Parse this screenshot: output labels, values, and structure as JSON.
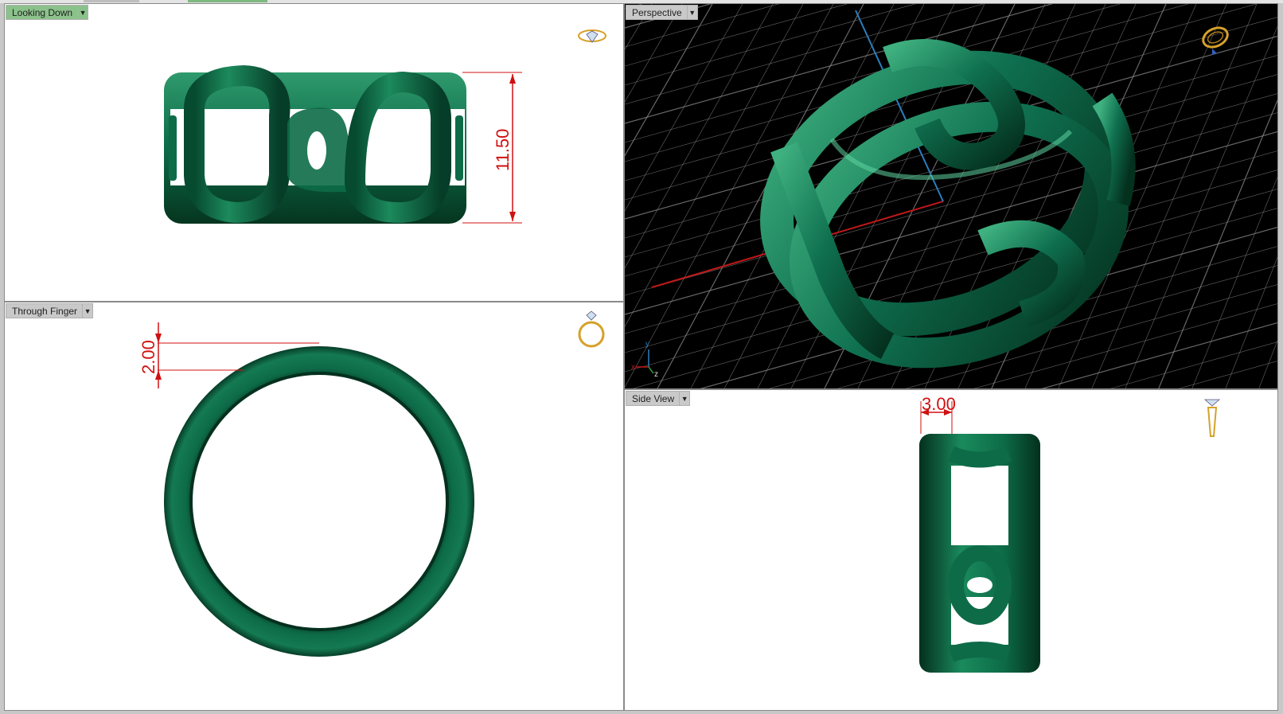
{
  "viewports": {
    "top_left": {
      "label": "Looking Down",
      "dimension": "11.50"
    },
    "top_right": {
      "label": "Perspective",
      "axis_y": "y",
      "axis_x": "x",
      "axis_z": "z"
    },
    "bottom_left": {
      "label": "Through Finger",
      "dimension": "2.00"
    },
    "bottom_right": {
      "label": "Side View",
      "dimension": "3.00"
    }
  },
  "icons": {
    "dropdown": "chevron-down-icon",
    "top_left_nav": "ring-top-view-icon",
    "top_right_nav": "ring-perspective-icon",
    "bottom_left_nav": "ring-front-view-icon",
    "bottom_right_nav": "ring-side-view-icon"
  },
  "colors": {
    "ring": "#0d6b48",
    "ring_dark": "#063d28",
    "ring_light": "#3aa77a",
    "dimension": "#d01010",
    "active_tab": "#8bc28b",
    "grid": "#8a8a8a",
    "x_axis": "#c01818",
    "y_axis": "#2a7fc0"
  }
}
